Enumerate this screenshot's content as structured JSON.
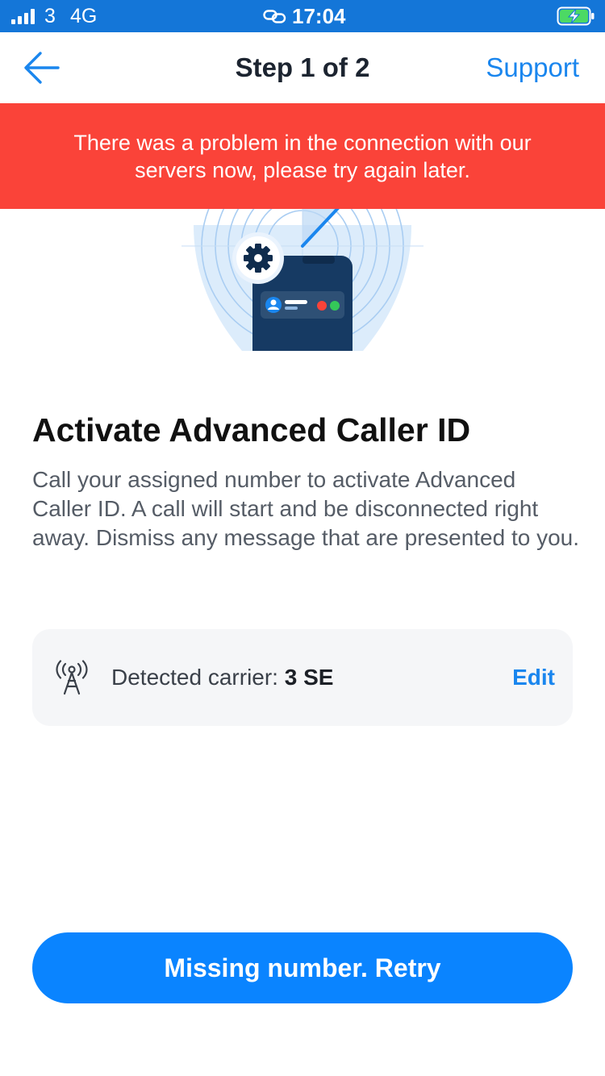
{
  "status_bar": {
    "carrier": "3",
    "network": "4G",
    "time": "17:04",
    "icons": [
      "signal-icon",
      "link-icon",
      "battery-charging-icon"
    ]
  },
  "nav": {
    "back_icon": "arrow-left-icon",
    "title": "Step 1 of 2",
    "support_label": "Support"
  },
  "error_banner": {
    "message": "There was a problem in the connection with our servers now, please try again later."
  },
  "main": {
    "illustration_icon": "phone-caller-id-illustration",
    "heading": "Activate Advanced Caller ID",
    "description": "Call your assigned number to activate Advanced Caller ID. A call will start and be disconnected right away. Dismiss any message that are presented to you."
  },
  "carrier_card": {
    "icon": "antenna-icon",
    "label": "Detected carrier:",
    "value": "3 SE",
    "edit_label": "Edit"
  },
  "primary_button": {
    "label": "Missing number. Retry"
  },
  "colors": {
    "status_bar": "#1476d8",
    "accent": "#0a84ff",
    "error": "#fa4339",
    "card_bg": "#f5f6f8"
  }
}
